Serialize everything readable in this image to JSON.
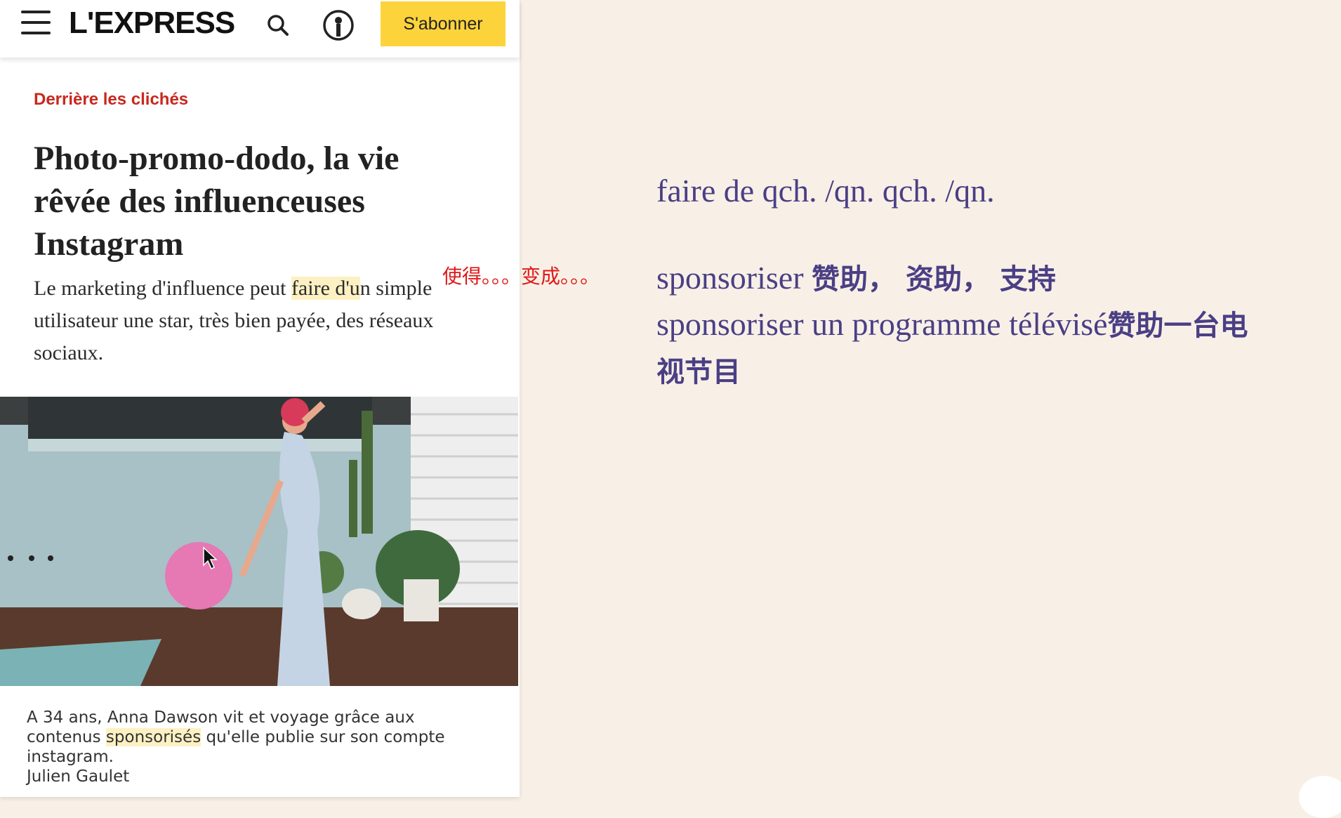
{
  "header": {
    "logo": "L'EXPRESS",
    "subscribe_label": "S'abonner",
    "icons": [
      "menu-icon",
      "search-icon",
      "account-icon"
    ]
  },
  "article": {
    "kicker": "Derrière les clichés",
    "headline": "Photo-promo-dodo, la vie rêvée des influenceuses Instagram",
    "lead": {
      "before": "Le marketing d'influence peut ",
      "highlight": "faire d'u",
      "after": "n simple utilisateur une star, très bien payée, des réseaux sociaux."
    },
    "caption": {
      "part1": "A 34 ans, Anna Dawson vit et voyage grâce aux contenus ",
      "highlight": "sponsorisés",
      "part2": " qu'elle publie sur son compte instagram.",
      "credit": "Julien Gaulet"
    }
  },
  "annotation_red": "使得。。。变成。。。",
  "notes": {
    "line1": "faire de qch. /qn.  qch. /qn.",
    "line2_fr": "sponsoriser ",
    "line2_cn": "赞助， 资助， 支持",
    "line3_fr": "sponsoriser un programme télévisé",
    "line3_cn": "赞助一台电",
    "line4_cn": "视节目"
  },
  "colors": {
    "accent_red": "#c8281e",
    "subscribe_yellow": "#fdd33b",
    "notes_purple": "#4a3f85",
    "background": "#f8f0e6"
  }
}
